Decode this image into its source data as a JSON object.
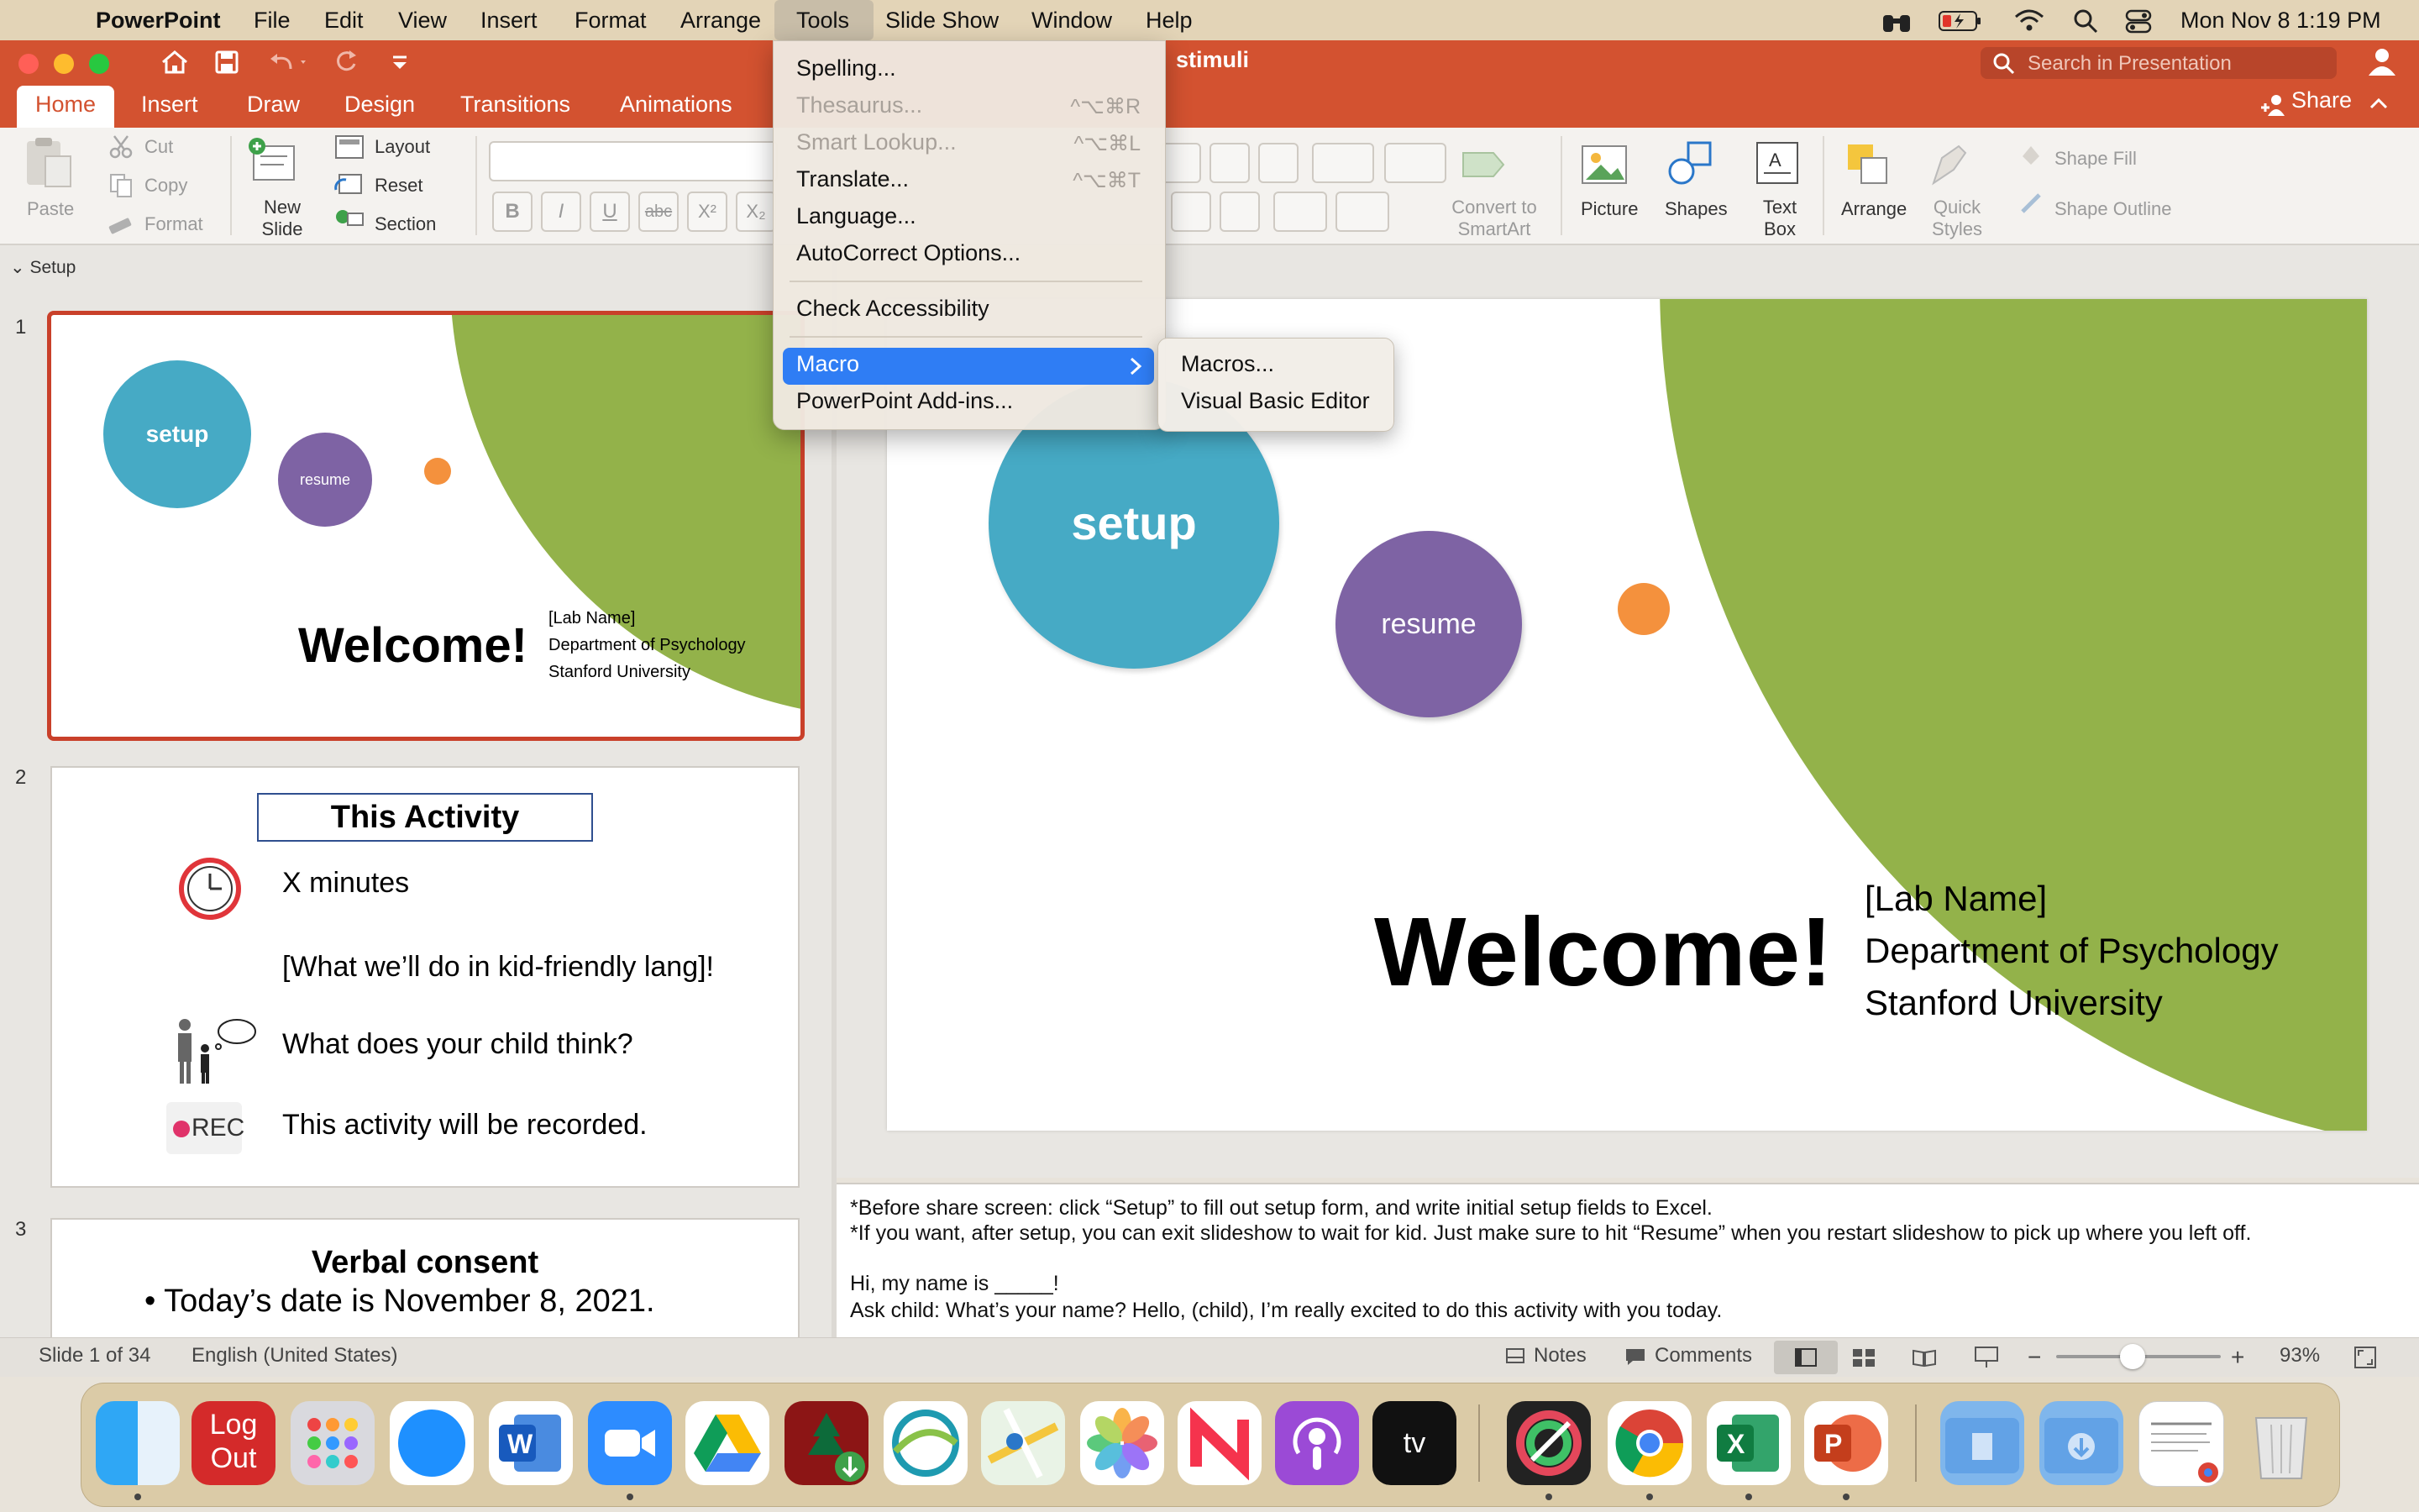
{
  "menubar": {
    "app": "PowerPoint",
    "items": [
      "File",
      "Edit",
      "View",
      "Insert",
      "Format",
      "Arrange",
      "Tools",
      "Slide Show",
      "Window",
      "Help"
    ],
    "clock": "Mon Nov 8  1:19 PM"
  },
  "window": {
    "title": "stimuli",
    "search_placeholder": "Search in Presentation"
  },
  "tabs": [
    "Home",
    "Insert",
    "Draw",
    "Design",
    "Transitions",
    "Animations"
  ],
  "share_label": "Share",
  "ribbon": {
    "paste": "Paste",
    "cut": "Cut",
    "copy": "Copy",
    "format": "Format",
    "new_slide": "New Slide",
    "layout": "Layout",
    "reset": "Reset",
    "section": "Section",
    "convert_smartart": "Convert to SmartArt",
    "picture": "Picture",
    "shapes": "Shapes",
    "text_box": "Text Box",
    "arrange": "Arrange",
    "quick_styles": "Quick Styles",
    "shape_fill": "Shape Fill",
    "shape_outline": "Shape Outline",
    "fmt_bold": "B",
    "fmt_italic": "I",
    "fmt_underline": "U",
    "fmt_strike": "abc",
    "fmt_super": "X²",
    "fmt_sub": "X₂"
  },
  "tools_menu": {
    "items": [
      {
        "label": "Spelling...",
        "shortcut": "",
        "enabled": true
      },
      {
        "label": "Thesaurus...",
        "shortcut": "^⌥⌘R",
        "enabled": false
      },
      {
        "label": "Smart Lookup...",
        "shortcut": "^⌥⌘L",
        "enabled": false
      },
      {
        "label": "Translate...",
        "shortcut": "^⌥⌘T",
        "enabled": true
      },
      {
        "label": "Language...",
        "shortcut": "",
        "enabled": true
      },
      {
        "label": "AutoCorrect Options...",
        "shortcut": "",
        "enabled": true
      },
      {
        "label": "Check Accessibility",
        "shortcut": "",
        "enabled": true
      },
      {
        "label": "Macro",
        "shortcut": "",
        "enabled": true,
        "highlighted": true
      },
      {
        "label": "PowerPoint Add-ins...",
        "shortcut": "",
        "enabled": true
      }
    ],
    "macro_submenu": [
      "Macros...",
      "Visual Basic Editor"
    ]
  },
  "left_pane": {
    "section": "Setup",
    "slides": [
      {
        "number": "1",
        "setup": "setup",
        "resume": "resume",
        "welcome": "Welcome!",
        "lab_name": "[Lab Name]",
        "department": "Department of Psychology",
        "university": "Stanford University"
      },
      {
        "number": "2",
        "title": "This Activity",
        "line1": "X minutes",
        "line2": "[What we’ll do in kid-friendly lang]!",
        "line3": "What does your child think?",
        "line4": "This activity will be recorded.",
        "rec": "REC"
      },
      {
        "number": "3",
        "title": "Verbal consent",
        "bullet1": "• Today’s date is November 8, 2021."
      }
    ]
  },
  "main_slide": {
    "setup": "setup",
    "resume": "resume",
    "welcome": "Welcome!",
    "lab_name": "[Lab Name]",
    "department": "Department of Psychology",
    "university": "Stanford University"
  },
  "notes": [
    "*Before share screen: click “Setup” to fill out setup form, and write initial setup fields to Excel.",
    "*If you want, after setup, you can exit slideshow to wait for kid. Just make sure to hit “Resume” when you restart slideshow to pick up where you left off.",
    "",
    "Hi, my name is _____!",
    "Ask child: What’s your name? Hello, (child), I’m really excited to do this activity with you today."
  ],
  "status": {
    "slide_count": "Slide 1 of 34",
    "language": "English (United States)",
    "notes": "Notes",
    "comments": "Comments",
    "zoom": "93%"
  },
  "dock": {
    "logout_line1": "Log",
    "logout_line2": "Out"
  },
  "colors": {
    "ppt_orange": "#d35230",
    "teal": "#46aac5",
    "purple": "#7e63a4",
    "green": "#93b24a",
    "orange_dot": "#f4913d",
    "menu_highlight": "#2f7df4"
  }
}
